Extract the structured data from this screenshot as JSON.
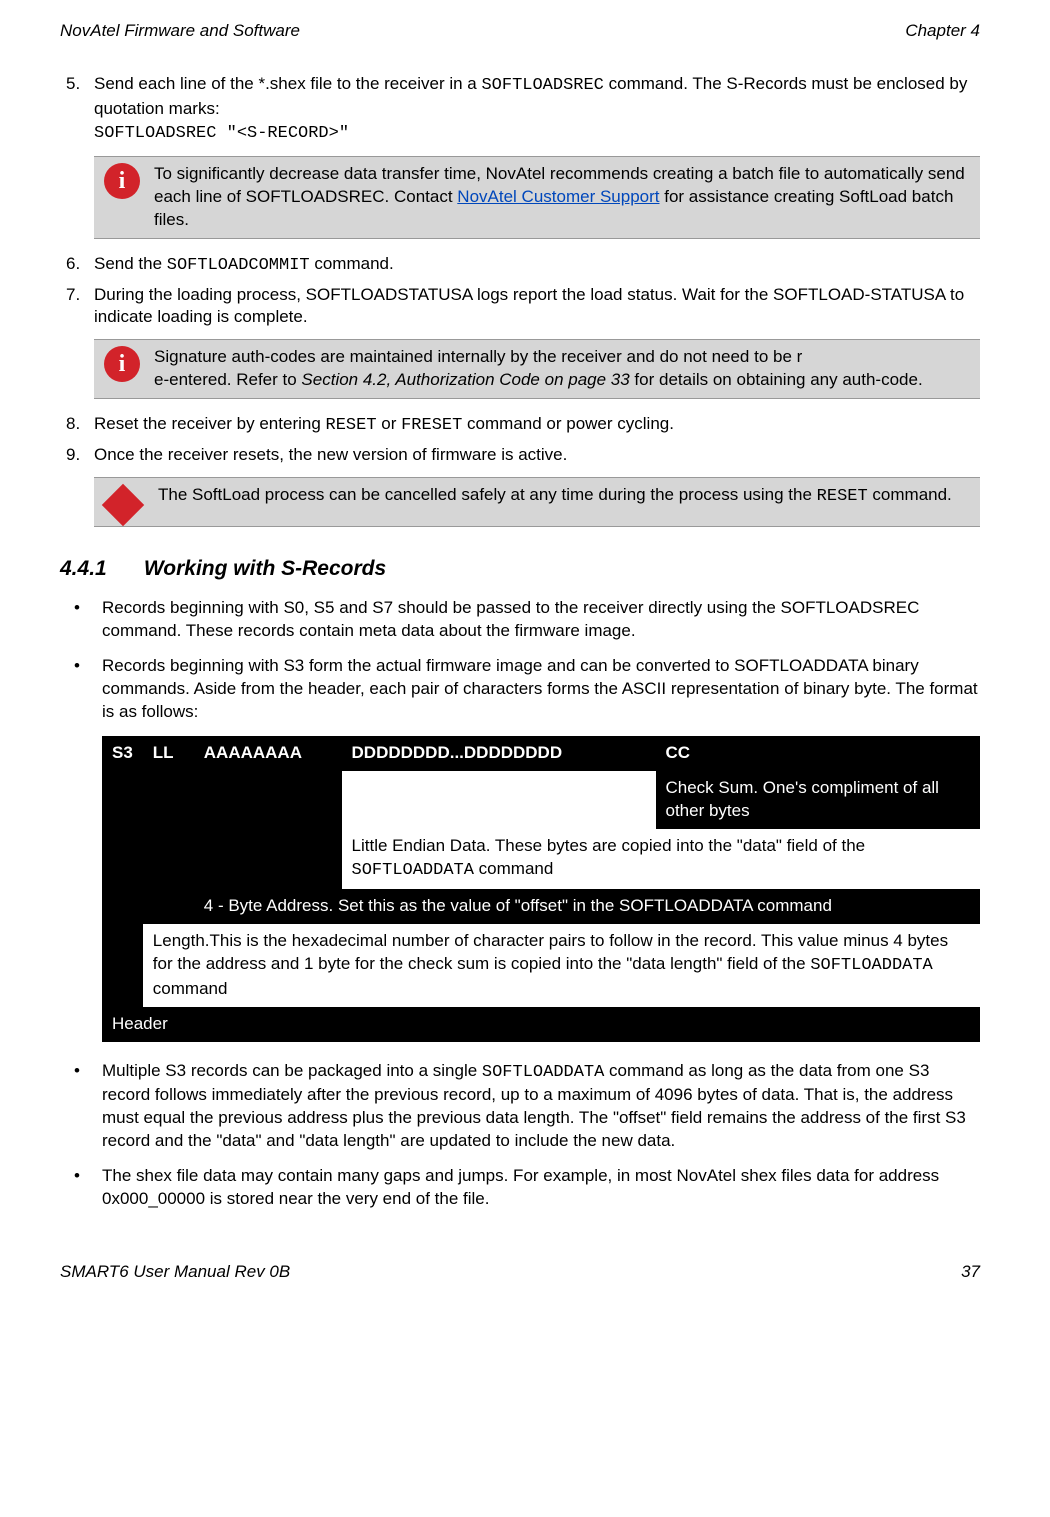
{
  "header": {
    "left": "NovAtel Firmware and Software",
    "right": "Chapter 4"
  },
  "footer": {
    "left": "SMART6 User Manual Rev 0B",
    "right": "37"
  },
  "steps": {
    "s5": {
      "num": "5.",
      "text": "Send each line of the *.shex file to the receiver in a ",
      "code1": "SOFTLOADSREC",
      "text2": " command. The S-Records must be enclosed by quotation marks:",
      "codeLine": "SOFTLOADSREC \"<S-RECORD>\""
    },
    "callout1": {
      "t1": "To significantly decrease data transfer time, NovAtel recommends creating a batch file to automatically send each line of SOFTLOADSREC. Contact ",
      "link": "NovAtel Customer Support",
      "t2": " for assistance creating SoftLoad batch files."
    },
    "s6": {
      "num": "6.",
      "t1": "Send the ",
      "code": "SOFTLOADCOMMIT",
      "t2": " command."
    },
    "s7": {
      "num": "7.",
      "t": "During the loading process, SOFTLOADSTATUSA logs report the load status. Wait for the SOFTLOAD-STATUSA to indicate loading is complete."
    },
    "callout2": {
      "t1": "Signature auth-codes are maintained internally by the receiver and do not need to be r",
      "t2": "e-entered. Refer to ",
      "it": "Section 4.2, Authorization Code on page 33",
      "t3": " for details on obtaining any auth-code."
    },
    "s8": {
      "num": "8.",
      "t1": "Reset the receiver by entering ",
      "c1": "RESET",
      "t2": " or ",
      "c2": "FRESET",
      "t3": " command or power cycling."
    },
    "s9": {
      "num": "9.",
      "t": "Once the receiver resets, the new version of firmware is active."
    },
    "callout3": {
      "t1": "The SoftLoad process can be cancelled safely at any time during the process using the ",
      "code": "RESET",
      "t2": " command."
    }
  },
  "section": {
    "num": "4.4.1",
    "title": "Working with S-Records"
  },
  "bullets": {
    "b1": "Records beginning with S0, S5 and S7 should be passed to the receiver directly using the SOFTLOADSREC command. These records contain meta data about the firmware image.",
    "b2": "Records beginning with S3 form the actual firmware image and can be converted to SOFTLOADDATA binary commands. Aside from the header, each pair of characters forms the ASCII representation of binary byte. The format is as follows:",
    "b3_a": "Multiple S3 records can be packaged into a single ",
    "b3_code": "SOFTLOADDATA",
    "b3_b": " command as long as the data from one S3 record follows immediately after the previous record, up to a maximum of 4096 bytes of data. That is, the address must equal the previous address plus the previous data length. The \"offset\" field remains the address of the first S3 record and the \"data\" and \"data length\" are updated to include the new data.",
    "b4": "The shex file data may contain many gaps and jumps. For example, in most NovAtel shex files data for address 0x000_00000 is stored near the very end of the file."
  },
  "table": {
    "r1": {
      "c1": "S3",
      "c2": "LL",
      "c3": "AAAAAAAA",
      "c4": "DDDDDDDD...DDDDDDDD",
      "c5": "CC"
    },
    "r2": "Check Sum. One's compliment of all other bytes",
    "r3a": "Little Endian Data. These bytes are copied into the \"data\" field of the ",
    "r3b": "SOFTLOADDATA",
    "r3c": " command",
    "r4": "4 - Byte Address. Set this as the value of \"offset\" in the SOFTLOADDATA command",
    "r5a": "Length.This is the hexadecimal number of character pairs to follow in the record. This value minus 4 bytes for the address and 1 byte for the check sum is copied into the \"data length\" field of the ",
    "r5b": "SOFTLOADDATA",
    "r5c": " command",
    "r6": "Header"
  }
}
